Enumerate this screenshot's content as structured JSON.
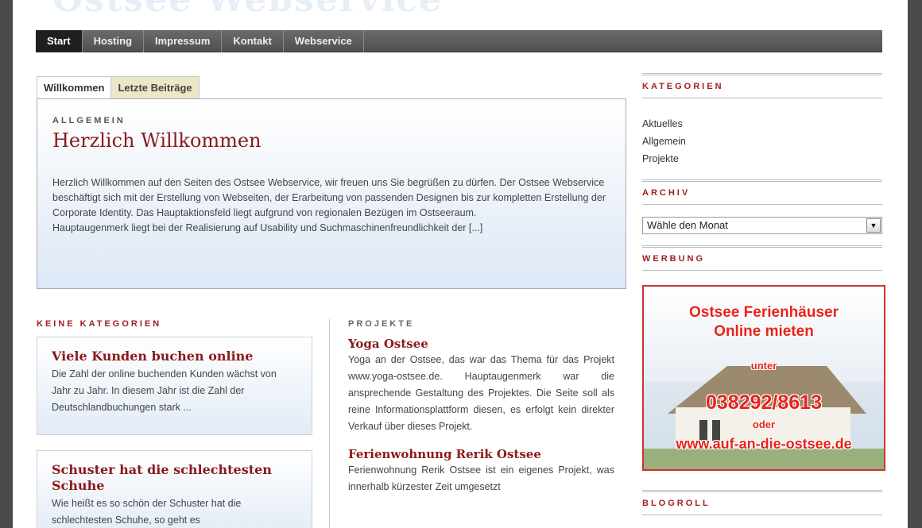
{
  "site": {
    "logo_text": "Ostsee Webservice"
  },
  "nav": {
    "items": [
      "Start",
      "Hosting",
      "Impressum",
      "Kontakt",
      "Webservice"
    ]
  },
  "tabs": [
    "Willkommen",
    "Letzte Beiträge"
  ],
  "featured": {
    "category": "ALLGEMEIN",
    "title": "Herzlich Willkommen",
    "body": "Herzlich Willkommen auf den Seiten des Ostsee Webservice, wir freuen uns Sie begrüßen zu dürfen. Der Ostsee Webservice beschäftigt sich mit der Erstellung von Webseiten, der Erarbeitung von passenden Designen bis zur kompletten Erstellung der Corporate Identity. Das Hauptaktionsfeld liegt aufgrund von regionalen Bezügen im Ostseeraum.",
    "body2": "Hauptaugenmerk liegt bei der Realisierung auf Usability und Suchmaschinenfreundlichkeit der [...]"
  },
  "left_column": {
    "heading": "KEINE KATEGORIEN",
    "posts": [
      {
        "title": "Viele Kunden buchen online",
        "excerpt": "Die Zahl der online buchenden Kunden wächst von Jahr zu Jahr. In diesem Jahr ist die Zahl der Deutschlandbuchungen stark ..."
      },
      {
        "title": "Schuster hat die schlechtesten Schuhe",
        "excerpt": "Wie heißt es so schön der Schuster hat die schlechtesten Schuhe, so geht es"
      }
    ]
  },
  "mid_column": {
    "heading": "PROJEKTE",
    "posts": [
      {
        "title": "Yoga Ostsee",
        "excerpt": "Yoga an der Ostsee, das war das Thema für das Projekt www.yoga-ostsee.de. Hauptaugenmerk war die ansprechende Gestaltung des Projektes. Die Seite soll als reine Informationsplattform diesen, es erfolgt kein direkter Verkauf über dieses Projekt."
      },
      {
        "title": "Ferienwohnung Rerik Ostsee",
        "excerpt": "Ferienwohnung Rerik Ostsee ist ein eigenes Projekt, was innerhalb kürzester Zeit umgesetzt"
      }
    ]
  },
  "sidebar": {
    "categories_heading": "KATEGORIEN",
    "categories": [
      "Aktuelles",
      "Allgemein",
      "Projekte"
    ],
    "archive_heading": "ARCHIV",
    "archive_select": "Wähle den Monat",
    "ad_heading": "WERBUNG",
    "ad": {
      "line1": "Ostsee Ferienhäuser",
      "line2": "Online mieten",
      "line3": "unter",
      "phone": "038292/8613",
      "line4": "oder",
      "url": "www.auf-an-die-ostsee.de"
    },
    "blogroll_heading": "BLOGROLL"
  },
  "colors": {
    "accent": "#8b1a1a",
    "nav_bg": "#5a5a5a",
    "nav_active": "#1f1f1f"
  }
}
